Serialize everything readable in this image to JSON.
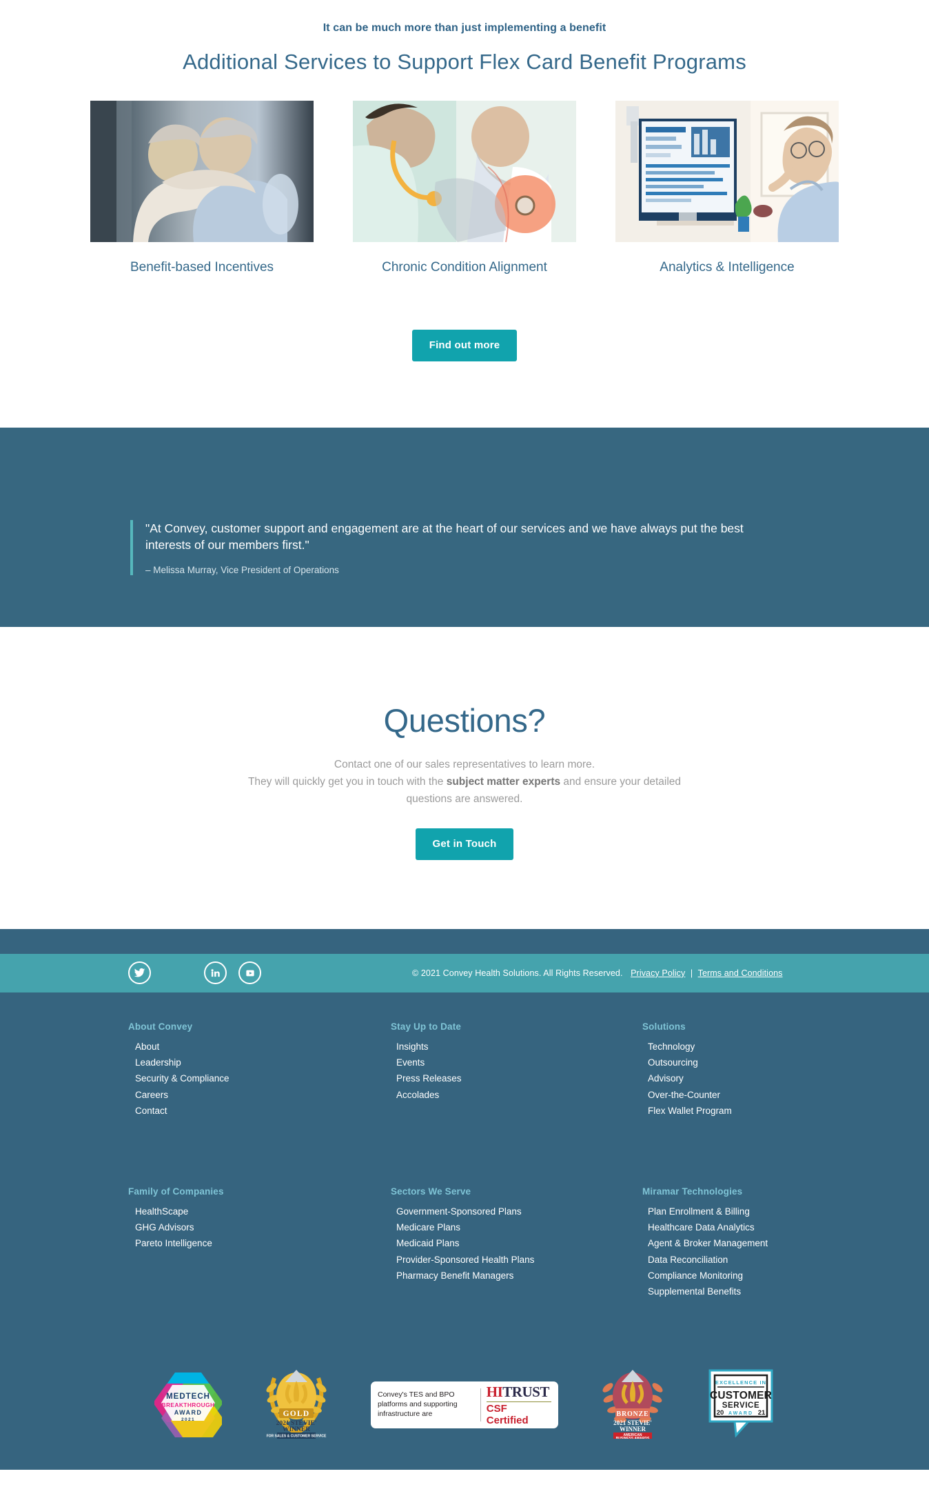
{
  "services": {
    "eyebrow": "It can be much more than just implementing a benefit",
    "title": "Additional Services to Support Flex Card Benefit Programs",
    "cards": [
      {
        "label": "Benefit-based Incentives",
        "image_alt": "senior-couple-embracing-photo"
      },
      {
        "label": "Chronic Condition Alignment",
        "image_alt": "doctor-examining-senior-patient-photo"
      },
      {
        "label": "Analytics & Intelligence",
        "image_alt": "woman-viewing-analytics-dashboard-photo"
      }
    ],
    "cta_label": "Find out more"
  },
  "quote": {
    "text": "\"At Convey, customer support and engagement are at the heart of our services and we have always put the best interests of our members first.\"",
    "author": "– Melissa Murray, Vice President of Operations"
  },
  "questions": {
    "title": "Questions?",
    "line1": "Contact one of our sales representatives to learn more.",
    "line2_a": "They will quickly get you in touch with the ",
    "line2_bold": "subject matter experts",
    "line2_b": " and ensure your detailed questions are answered.",
    "cta_label": "Get in Touch"
  },
  "footer": {
    "social": [
      {
        "name": "twitter",
        "label": "Twitter"
      },
      {
        "name": "linkedin",
        "label": "LinkedIn"
      },
      {
        "name": "youtube",
        "label": "YouTube"
      }
    ],
    "copyright": "© 2021 Convey Health Solutions. All Rights Reserved.",
    "privacy_label": "Privacy Policy",
    "separator": "|",
    "terms_label": "Terms and Conditions",
    "columns": [
      {
        "heading": "About Convey",
        "items": [
          "About",
          "Leadership",
          "Security & Compliance",
          "Careers",
          "Contact"
        ]
      },
      {
        "heading": "Stay Up to Date",
        "items": [
          "Insights",
          "Events",
          "Press Releases",
          "Accolades"
        ]
      },
      {
        "heading": "Solutions",
        "items": [
          "Technology",
          "Outsourcing",
          "Advisory",
          "Over-the-Counter",
          "Flex Wallet Program"
        ]
      },
      {
        "heading": "Family of Companies",
        "items": [
          "HealthScape",
          "GHG Advisors",
          "Pareto Intelligence"
        ]
      },
      {
        "heading": "Sectors We Serve",
        "items": [
          "Government-Sponsored Plans",
          "Medicare Plans",
          "Medicaid Plans",
          "Provider-Sponsored Health Plans",
          "Pharmacy Benefit Managers"
        ]
      },
      {
        "heading": "Miramar Technologies",
        "items": [
          "Plan Enrollment & Billing",
          "Healthcare Data Analytics",
          "Agent & Broker Management",
          "Data Reconciliation",
          "Compliance Monitoring",
          "Supplemental Benefits"
        ]
      }
    ],
    "badges": {
      "medtech": {
        "line1": "MEDTECH",
        "line2": "BREAKTHROUGH",
        "line3": "AWARD",
        "line4": "2021"
      },
      "stevie_gold": {
        "rank": "GOLD",
        "line1": "2021 STEVIE'",
        "line2": "WINNER",
        "line3": "FOR SALES &",
        "line4": "CUSTOMER SERVICE"
      },
      "hitrust": {
        "text": "Convey's TES and BPO platforms and supporting infrastructure are",
        "logo_hi": "HI",
        "logo_trust": "TRUST",
        "certified": "CSF Certified"
      },
      "stevie_bronze": {
        "rank": "BRONZE",
        "line1": "2021 STEVIE'",
        "line2": "WINNER",
        "line3": "AMERICAN",
        "line4": "BUSINESS AWARDS"
      },
      "customer_service": {
        "line1": "EXCELLENCE IN",
        "line2": "CUSTOMER",
        "line3": "SERVICE",
        "line4": "AWARD",
        "year_left": "20",
        "year_right": "21"
      }
    }
  },
  "colors": {
    "deep_blue": "#36647f",
    "quote_blue": "#376780",
    "teal_button": "#11a3ad",
    "social_teal": "#45a3ad",
    "heading_blue": "#34688a",
    "footer_heading": "#7fc4d6"
  }
}
